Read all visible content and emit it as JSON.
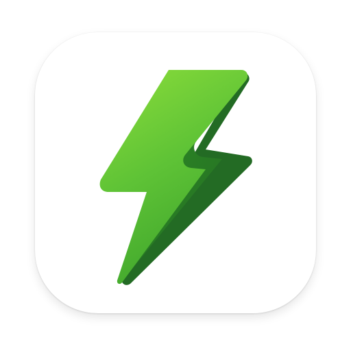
{
  "icon": {
    "name": "lightning-bolt-icon",
    "background_color": "#FFFFFF",
    "colors": {
      "highlight": "#86DA3A",
      "front": "#5FC336",
      "front_dark": "#3CA32B",
      "side_mid": "#2F8F24",
      "side_dark": "#236B24"
    }
  }
}
